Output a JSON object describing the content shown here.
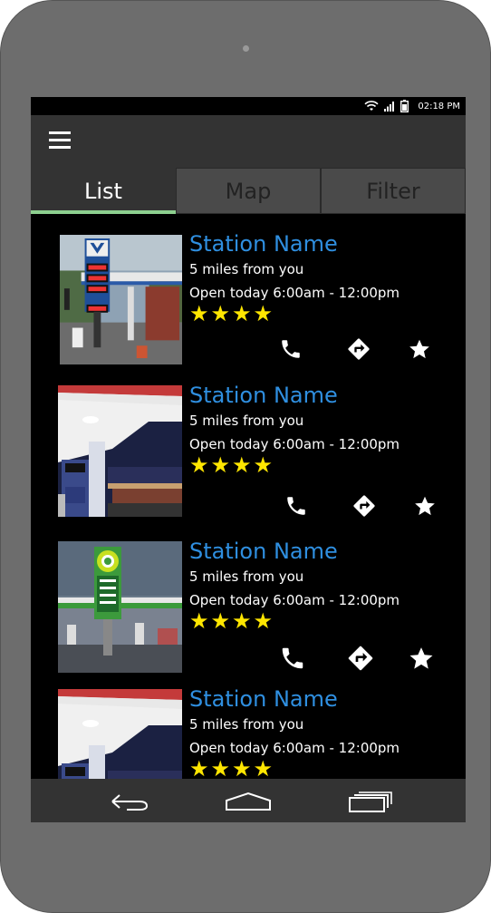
{
  "status_bar": {
    "time": "02:18 PM",
    "icons": [
      "wifi-icon",
      "signal-icon",
      "battery-icon"
    ]
  },
  "app_bar": {
    "menu_icon": "hamburger-menu-icon"
  },
  "tabs": [
    {
      "label": "List",
      "active": true
    },
    {
      "label": "Map",
      "active": false
    },
    {
      "label": "Filter",
      "active": false
    }
  ],
  "stations": [
    {
      "name": "Station Name",
      "distance": "5 miles from you",
      "hours": "Open today 6:00am - 12:00pm",
      "rating": 4,
      "stars": "★★★★",
      "photo": "valero-gas-station-photo"
    },
    {
      "name": "Station Name",
      "distance": "5 miles from you",
      "hours": "Open today 6:00am - 12:00pm",
      "rating": 4,
      "stars": "★★★★",
      "photo": "canopy-gas-station-photo"
    },
    {
      "name": "Station Name",
      "distance": "5 miles from you",
      "hours": "Open today 6:00am - 12:00pm",
      "rating": 4,
      "stars": "★★★★",
      "photo": "bp-gas-station-photo"
    },
    {
      "name": "Station Name",
      "distance": "5 miles from you",
      "hours": "Open today 6:00am - 12:00pm",
      "rating": 4,
      "stars": "★★★★",
      "photo": "canopy-gas-station-photo"
    }
  ],
  "actions": [
    "phone-icon",
    "directions-icon",
    "favorite-star-icon"
  ],
  "nav_bar": [
    "back-icon",
    "home-icon",
    "recent-apps-icon"
  ],
  "colors": {
    "accent_blue": "#2f8fe0",
    "star_yellow": "#ffe600",
    "tab_indicator": "#8dcf8f",
    "bar_gray": "#333333",
    "phone_body": "#6d6d6d"
  }
}
